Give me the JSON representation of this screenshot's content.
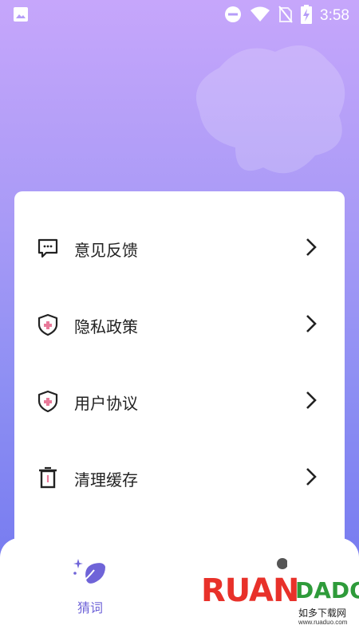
{
  "status_bar": {
    "time": "3:58",
    "icons": [
      "image-icon",
      "do-not-disturb-icon",
      "wifi-icon",
      "no-sim-icon",
      "battery-charging-icon"
    ]
  },
  "menu": {
    "items": [
      {
        "label": "意见反馈",
        "icon": "chat-bubble-icon"
      },
      {
        "label": "隐私政策",
        "icon": "shield-plus-icon"
      },
      {
        "label": "用户协议",
        "icon": "shield-plus-icon"
      },
      {
        "label": "清理缓存",
        "icon": "trash-icon"
      }
    ]
  },
  "bottom_nav": {
    "items": [
      {
        "label": "猜词",
        "icon": "sparkle-leaf-icon",
        "active": true
      },
      {
        "label": "",
        "icon": "profile-icon",
        "active": false
      }
    ]
  },
  "watermark": {
    "brand": "RUAN",
    "brand2": "DADO",
    "sub": "如多下载网",
    "url": "www.ruaduo.com"
  },
  "colors": {
    "accent": "#6f64d8",
    "card": "#ffffff",
    "text": "#222222",
    "shield_cross": "#e97a9a"
  }
}
